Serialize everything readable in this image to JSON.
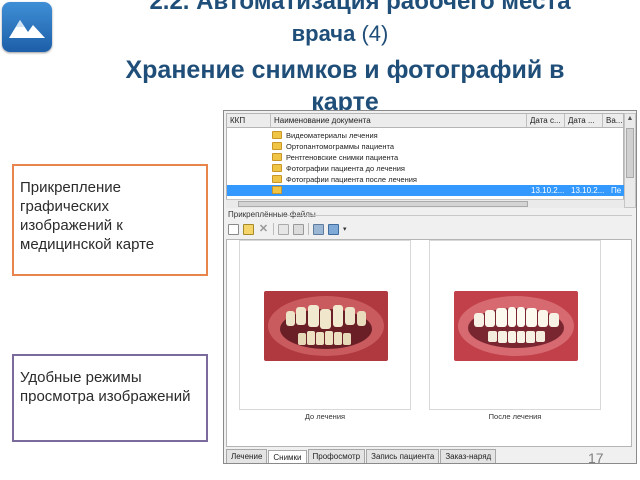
{
  "slide": {
    "title_line1": "2.2. Автоматизация рабочего места",
    "title_line2_text": "врача",
    "title_line2_num": "(4)",
    "title_line3": "Хранение снимков и фотографий в",
    "title_line4": "карте",
    "page_number": "17",
    "title_color": "#1f4e79"
  },
  "callouts": {
    "first": "Прикрепление графических изображений к медицинской карте",
    "second": "Удобные режимы просмотра изображений",
    "first_border": "#e8854a",
    "second_border": "#7a6b9c"
  },
  "grid": {
    "headers": [
      "ККП",
      "Наименование документа",
      "Дата с...",
      "Дата ...",
      "Ва..."
    ],
    "rows": [
      {
        "label": "Видеоматериалы лечения",
        "d1": "",
        "d2": "",
        "d3": ""
      },
      {
        "label": "Ортопантомограммы пациента",
        "d1": "",
        "d2": "",
        "d3": ""
      },
      {
        "label": "Рентгеновские снимки пациента",
        "d1": "",
        "d2": "",
        "d3": ""
      },
      {
        "label": "Фотографии пациента до лечения",
        "d1": "",
        "d2": "",
        "d3": ""
      },
      {
        "label": "Фотографии пациента после лечения",
        "d1": "",
        "d2": "",
        "d3": ""
      },
      {
        "label": "",
        "d1": "13.10.2...",
        "d2": "13.10.2...",
        "d3": "Пе"
      }
    ],
    "selected_row": 5
  },
  "attached": {
    "section_label": "Прикреплённые файлы",
    "captions": [
      "До лечения",
      "После лечения"
    ]
  },
  "tabs": [
    "Лечение",
    "Снимки",
    "Профосмотр",
    "Запись пациента",
    "Заказ-наряд"
  ],
  "active_tab": "Снимки"
}
